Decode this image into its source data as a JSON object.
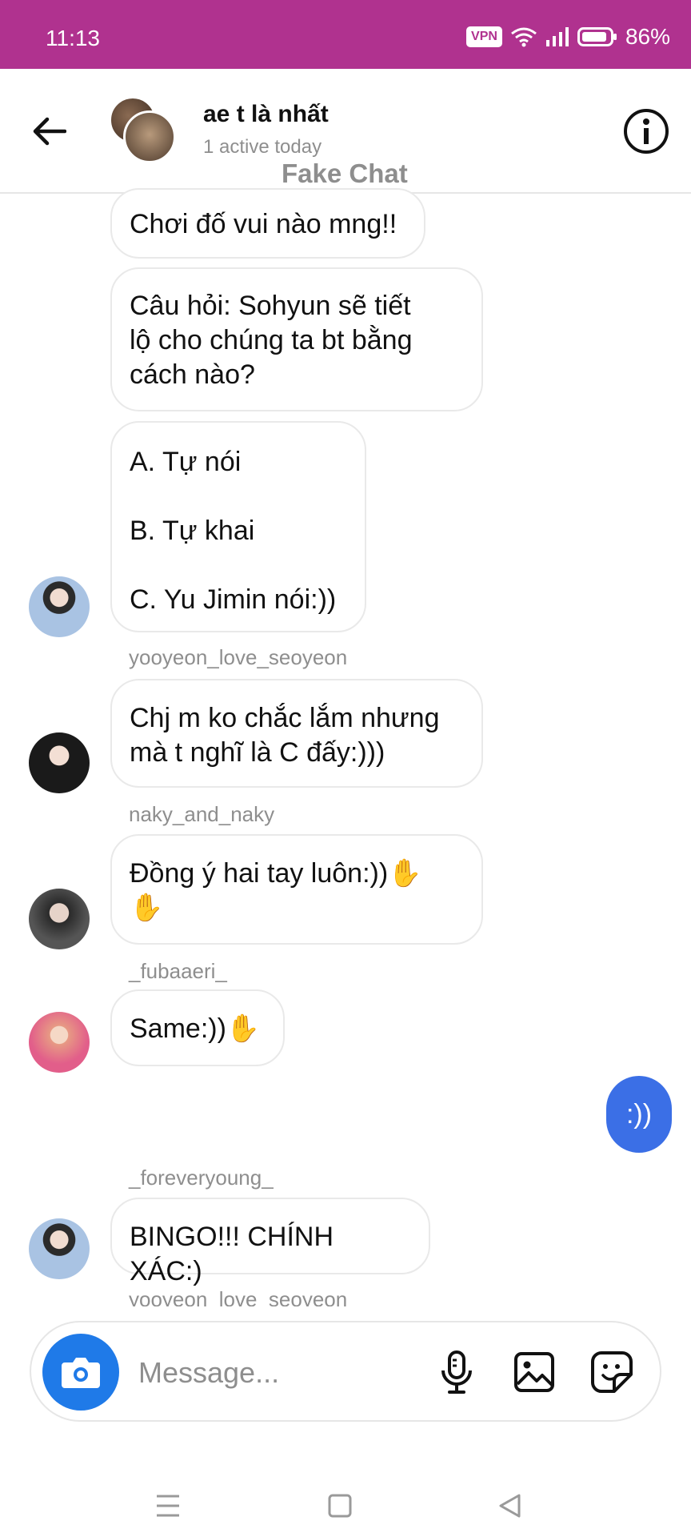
{
  "status_bar": {
    "time": "11:13",
    "vpn_label": "VPN",
    "battery": "86%",
    "color": "#b0328f"
  },
  "header": {
    "title": "ae t là nhất",
    "subtitle": "1 active today",
    "watermark": "Fake Chat"
  },
  "messages": [
    {
      "text": "Chơi đố vui nào mng!!"
    },
    {
      "text": "Câu hỏi: Sohyun sẽ tiết\nlộ cho chúng ta bt bằng\ncách nào?"
    },
    {
      "text": "A. Tự nói\n\nB. Tự khai\n\nC. Yu Jimin nói:))",
      "sender": "yooyeon_love_seoyeon"
    },
    {
      "text": "Chj m ko chắc lắm nhưng\nmà t nghĩ là C đấy:)))",
      "sender": "naky_and_naky"
    },
    {
      "text": "Đồng ý hai tay luôn:))✋\n✋",
      "sender": "_fubaaeri_"
    },
    {
      "text": "Same:))✋"
    },
    {
      "text": ":))",
      "mine": true
    },
    {
      "text": "BINGO!!! CHÍNH XÁC:)",
      "sender": "_foreveryoung_"
    }
  ],
  "cut_sender": "yooyeon_love_seoyeon",
  "composer": {
    "placeholder": "Message..."
  },
  "icons": [
    "back-arrow-icon",
    "info-icon",
    "camera-icon",
    "microphone-icon",
    "image-icon",
    "sticker-icon",
    "menu-icon",
    "home-icon",
    "back-triangle-icon"
  ],
  "accent_color": "#3b6fe6"
}
